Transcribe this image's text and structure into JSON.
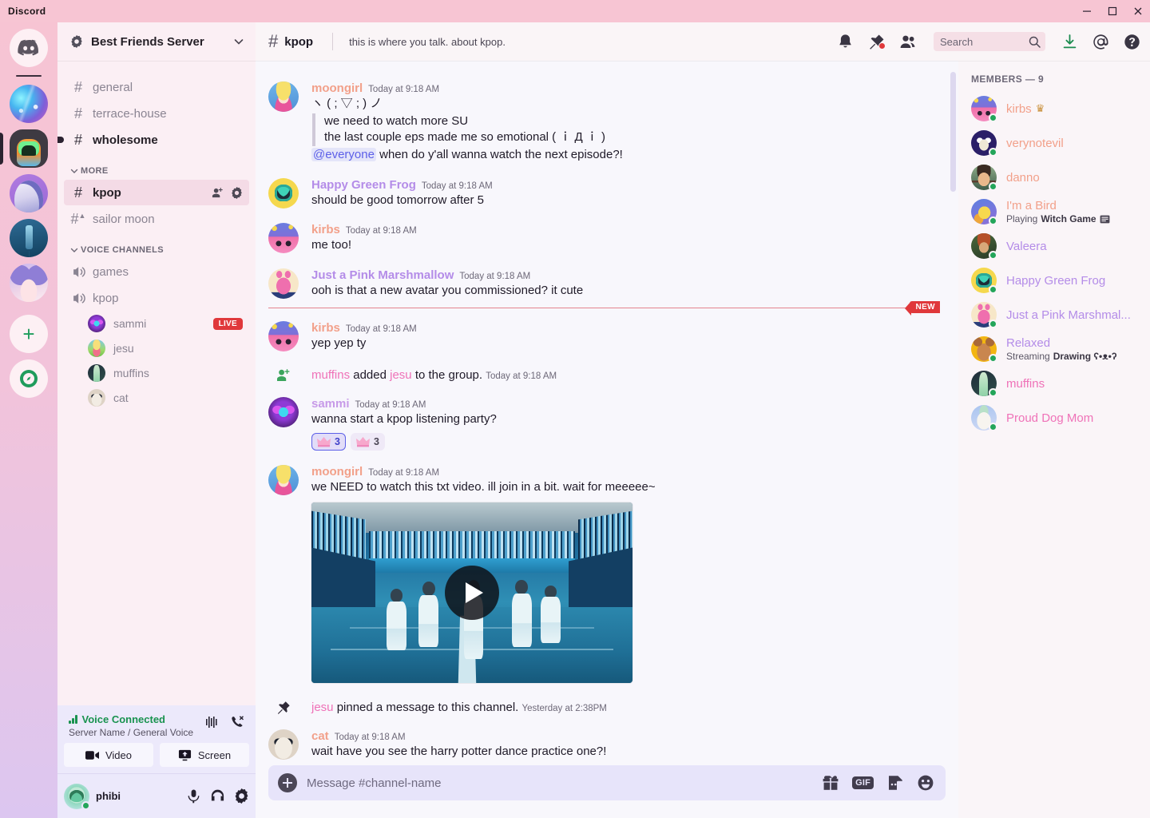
{
  "titlebar": {
    "brand": "Discord",
    "minimize": "minimize",
    "maximize": "maximize",
    "close": "close"
  },
  "server_rail": {
    "home_label": "Discord Home",
    "servers": [
      {
        "name": "Neon Concert Server",
        "active": false,
        "hover": false
      },
      {
        "name": "Best Friends Server",
        "active": true,
        "hover": false
      },
      {
        "name": "Astronaut Server",
        "active": false,
        "hover": false
      },
      {
        "name": "Lighthouse Server",
        "active": false,
        "hover": false
      },
      {
        "name": "Anime Server",
        "active": false,
        "hover": false
      }
    ],
    "add_label": "+",
    "explore_label": "Explore Public Servers"
  },
  "sidebar": {
    "server_name": "Best Friends Server",
    "categories": [
      {
        "label": "",
        "channels": [
          {
            "name": "general",
            "type": "text",
            "state": "read"
          },
          {
            "name": "terrace-house",
            "type": "text",
            "state": "read"
          },
          {
            "name": "wholesome",
            "type": "text",
            "state": "unread"
          }
        ]
      },
      {
        "label": "MORE",
        "channels": [
          {
            "name": "kpop",
            "type": "text",
            "state": "selected"
          },
          {
            "name": "sailor moon",
            "type": "announcement",
            "state": "read"
          }
        ]
      },
      {
        "label": "VOICE CHANNELS",
        "channels": [
          {
            "name": "games",
            "type": "voice",
            "state": "read"
          },
          {
            "name": "kpop",
            "type": "voice",
            "state": "read"
          }
        ]
      }
    ],
    "voice_members": [
      {
        "name": "sammi",
        "badge": "LIVE",
        "avatar": "av-sammi"
      },
      {
        "name": "jesu",
        "badge": "",
        "avatar": "av-jesu"
      },
      {
        "name": "muffins",
        "badge": "",
        "avatar": "av-muffins"
      },
      {
        "name": "cat",
        "badge": "",
        "avatar": "av-cat"
      }
    ],
    "voice_panel": {
      "status": "Voice Connected",
      "detail": "Server Name / General Voice",
      "video_label": "Video",
      "screen_label": "Screen"
    },
    "user": {
      "name": "phibi",
      "status_color": "#23a55a"
    }
  },
  "chat_header": {
    "channel": "kpop",
    "topic": "this is where you talk. about kpop.",
    "search_placeholder": "Search"
  },
  "messages": [
    {
      "kind": "message",
      "author": "moongirl",
      "color": "#f2a08a",
      "time": "Today at 9:18 AM",
      "avatar": "av-moongirl",
      "lines": [
        {
          "type": "text",
          "text": "ヽ ( ; ▽ ; ) ノ"
        },
        {
          "type": "quote",
          "text": "we need to watch more SU"
        },
        {
          "type": "quote",
          "text": "the last couple eps made me so emotional  ( ｉ Д ｉ )"
        },
        {
          "type": "mention",
          "mention": "@everyone",
          "text": " when do y'all wanna watch the next episode?!"
        }
      ]
    },
    {
      "kind": "message",
      "author": "Happy Green Frog",
      "color": "#b48ce8",
      "time": "Today at 9:18 AM",
      "avatar": "av-frog",
      "lines": [
        {
          "type": "text",
          "text": "should be good tomorrow after 5"
        }
      ]
    },
    {
      "kind": "message",
      "author": "kirbs",
      "color": "#f2a08a",
      "time": "Today at 9:18 AM",
      "avatar": "av-kirbs",
      "lines": [
        {
          "type": "text",
          "text": "me too!"
        }
      ]
    },
    {
      "kind": "message",
      "author": "Just a Pink Marshmallow",
      "color": "#b48ce8",
      "time": "Today at 9:18 AM",
      "avatar": "av-marsh",
      "lines": [
        {
          "type": "text",
          "text": "ooh is that a new avatar you commissioned? it cute"
        }
      ]
    },
    {
      "kind": "divider",
      "label": "NEW"
    },
    {
      "kind": "message",
      "author": "kirbs",
      "color": "#f2a08a",
      "time": "Today at 9:18 AM",
      "avatar": "av-kirbs",
      "lines": [
        {
          "type": "text",
          "text": "yep yep ty"
        }
      ]
    },
    {
      "kind": "system",
      "icon": "member-add-icon",
      "actor": "muffins",
      "actor_color": "#ef72b8",
      "middle": " added ",
      "target": "jesu",
      "target_color": "#ef72b8",
      "tail": " to the group.",
      "time": "Today at 9:18 AM"
    },
    {
      "kind": "message",
      "author": "sammi",
      "color": "#c79ae8",
      "time": "Today at 9:18 AM",
      "avatar": "av-sammi",
      "lines": [
        {
          "type": "text",
          "text": "wanna start a kpop listening party?"
        }
      ],
      "reactions": [
        {
          "emoji": "crown-pink-emoji",
          "count": "3",
          "me": true
        },
        {
          "emoji": "crown-pink-emoji",
          "count": "3",
          "me": false
        }
      ]
    },
    {
      "kind": "message",
      "author": "moongirl",
      "color": "#f2a08a",
      "time": "Today at 9:18 AM",
      "avatar": "av-moongirl",
      "lines": [
        {
          "type": "text",
          "text": "we NEED to watch this txt video. ill join in a bit. wait for meeeee~"
        }
      ],
      "embed": {
        "alt": "kpop music video thumbnail, five dancers in a blue gymnasium",
        "play": "play-button"
      }
    },
    {
      "kind": "system",
      "icon": "pin-icon",
      "actor": "jesu",
      "actor_color": "#ef72b8",
      "middle": " pinned a message to this channel.",
      "target": "",
      "target_color": "",
      "tail": "",
      "time": "Yesterday at 2:38PM"
    },
    {
      "kind": "message",
      "author": "cat",
      "color": "#f2a08a",
      "time": "Today at 9:18 AM",
      "avatar": "av-cat",
      "lines": [
        {
          "type": "text",
          "text": "wait have you see the harry potter dance practice one?!"
        }
      ]
    }
  ],
  "composer": {
    "placeholder": "Message #channel-name",
    "gif_label": "GIF"
  },
  "members": {
    "title": "MEMBERS — 9",
    "list": [
      {
        "name": "kirbs",
        "color": "#f2a08a",
        "avatar": "av-kirbs",
        "crown": "♛",
        "activity": "",
        "activity_app": "",
        "activity_icon": ""
      },
      {
        "name": "verynotevil",
        "color": "#f2a08a",
        "avatar": "av-verynotevil",
        "crown": "",
        "activity": "",
        "activity_app": "",
        "activity_icon": ""
      },
      {
        "name": "danno",
        "color": "#f2a08a",
        "avatar": "av-danno",
        "crown": "",
        "activity": "",
        "activity_app": "",
        "activity_icon": ""
      },
      {
        "name": "I'm a Bird",
        "color": "#f2a08a",
        "avatar": "av-bird",
        "crown": "",
        "activity": "Playing ",
        "activity_app": "Witch Game",
        "activity_icon": "game-card-icon"
      },
      {
        "name": "Valeera",
        "color": "#b48ce8",
        "avatar": "av-valeera",
        "crown": "",
        "activity": "",
        "activity_app": "",
        "activity_icon": ""
      },
      {
        "name": "Happy Green Frog",
        "color": "#b48ce8",
        "avatar": "av-frog",
        "crown": "",
        "activity": "",
        "activity_app": "",
        "activity_icon": ""
      },
      {
        "name": "Just a Pink Marshmal...",
        "color": "#b48ce8",
        "avatar": "av-marsh",
        "crown": "",
        "activity": "",
        "activity_app": "",
        "activity_icon": ""
      },
      {
        "name": "Relaxed",
        "color": "#b48ce8",
        "avatar": "av-relaxed",
        "crown": "",
        "activity": "Streaming ",
        "activity_app": "Drawing ʕ•ᴥ•ʔ",
        "activity_icon": ""
      },
      {
        "name": "muffins",
        "color": "#ef72b8",
        "avatar": "av-muffins",
        "crown": "",
        "activity": "",
        "activity_app": "",
        "activity_icon": ""
      },
      {
        "name": "Proud Dog Mom",
        "color": "#ef72b8",
        "avatar": "av-dogmom",
        "crown": "",
        "activity": "",
        "activity_app": "",
        "activity_icon": ""
      }
    ]
  },
  "colors": {
    "accent_green": "#23a55a",
    "red_badge": "#e0383b",
    "mention_blue": "#5d60e8",
    "rail_gradient_start": "#f7c4d3",
    "rail_gradient_end": "#dcc6f0"
  }
}
